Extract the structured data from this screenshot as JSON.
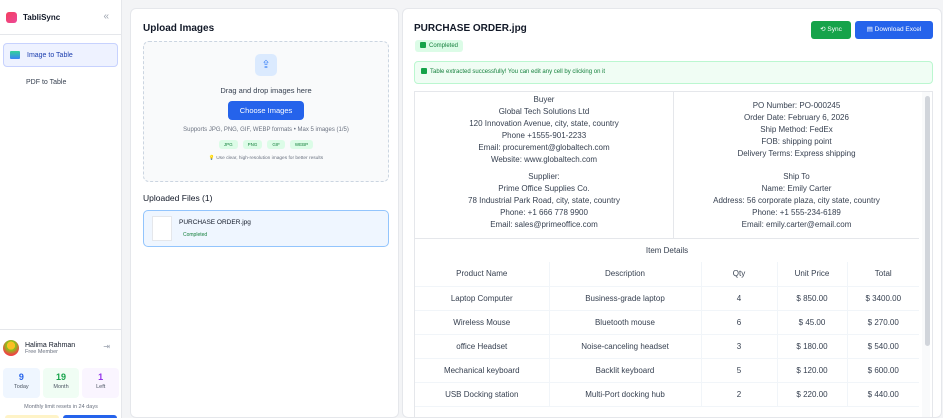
{
  "app": {
    "name": "TabliSync",
    "collapse_icon": "double-chevron-left-icon"
  },
  "sidebar": {
    "items": [
      {
        "label": "Image to Table",
        "active": true,
        "icon": "image-icon"
      },
      {
        "label": "PDF to Table",
        "active": false,
        "icon": "pdf-icon"
      }
    ]
  },
  "user": {
    "name": "Halima Rahman",
    "role": "Free Member",
    "stats": [
      {
        "value": "9",
        "label": "Today"
      },
      {
        "value": "19",
        "label": "Month"
      },
      {
        "value": "1",
        "label": "Left"
      }
    ],
    "limit_text": "Monthly limit resets in 24 days"
  },
  "upload": {
    "title": "Upload Images",
    "drop_text": "Drag and drop images here",
    "choose_label": "Choose Images",
    "supports": "Supports JPG, PNG, GIF, WEBP formats • Max 5 images (1/5)",
    "formats": [
      "JPG",
      "PNG",
      "GIF",
      "WEBP"
    ],
    "tip": "Use clear, high-resolution images for better results",
    "files_title": "Uploaded Files (1)",
    "file": {
      "name": "PURCHASE ORDER.jpg",
      "status": "Completed"
    }
  },
  "result": {
    "title": "PURCHASE ORDER.jpg",
    "status": "Completed",
    "sync_label": "Sync",
    "excel_label": "Download Excel",
    "success_msg": "Table extracted successfully! You can edit any cell by clicking on it",
    "buyer": [
      "Buyer",
      "Global Tech Solutions Ltd",
      "120 Innovation Avenue, city, state, country",
      "Phone +1555-901-2233",
      "Email: procurement@globaltech.com",
      "Website: www.globaltech.com"
    ],
    "po": [
      "PO Number: PO-000245",
      "Order Date: February 6, 2026",
      "Ship Method: FedEx",
      "FOB: shipping point",
      "Delivery Terms: Express shipping"
    ],
    "supplier": [
      "Supplier:",
      "Prime Office Supplies Co.",
      "78 Industrial Park Road, city, state, country",
      "Phone: +1 666 778 9900",
      "Email: sales@primeoffice.com"
    ],
    "shipto": [
      "Ship To",
      "Name: Emily Carter",
      "Address: 56 corporate plaza, city state, country",
      "Phone: +1 555-234-6189",
      "Email: emily.carter@email.com"
    ],
    "items_title": "Item Details",
    "table": {
      "headers": [
        "Product Name",
        "Description",
        "Qty",
        "Unit Price",
        "Total"
      ],
      "rows": [
        [
          "Laptop Computer",
          "Business-grade laptop",
          "4",
          "$ 850.00",
          "$ 3400.00"
        ],
        [
          "Wireless Mouse",
          "Bluetooth mouse",
          "6",
          "$ 45.00",
          "$ 270.00"
        ],
        [
          "office Headset",
          "Noise-canceling headset",
          "3",
          "$ 180.00",
          "$ 540.00"
        ],
        [
          "Mechanical keyboard",
          "Backlit keyboard",
          "5",
          "$ 120.00",
          "$ 600.00"
        ],
        [
          "USB Docking station",
          "Multi-Port docking hub",
          "2",
          "$ 220.00",
          "$ 440.00"
        ]
      ]
    }
  }
}
